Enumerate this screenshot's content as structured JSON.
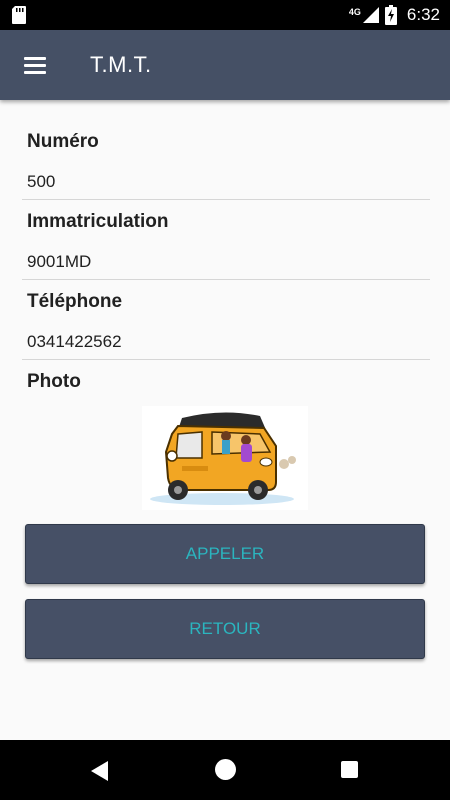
{
  "status_bar": {
    "network": "4G",
    "time": "6:32"
  },
  "app_bar": {
    "title": "T.M.T."
  },
  "fields": [
    {
      "label": "Numéro",
      "value": "500"
    },
    {
      "label": "Immatriculation",
      "value": "9001MD"
    },
    {
      "label": "Téléphone",
      "value": "0341422562"
    }
  ],
  "photo": {
    "label": "Photo"
  },
  "buttons": {
    "call_label": "APPELER",
    "back_label": "RETOUR"
  },
  "colors": {
    "app_bar": "#455065",
    "button_bg": "#465066",
    "button_text": "#2bb5bf",
    "background": "#fafafa"
  },
  "icons": {
    "menu": "hamburger-menu-icon",
    "sd_card": "sd-card-icon",
    "signal": "signal-icon",
    "battery": "battery-charging-icon"
  }
}
